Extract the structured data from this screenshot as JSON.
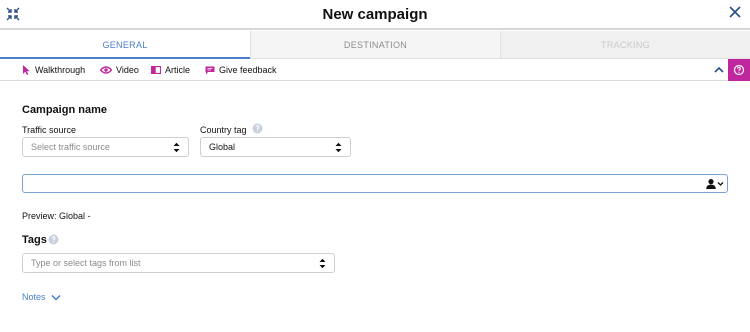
{
  "header": {
    "title": "New campaign"
  },
  "tabs": [
    {
      "label": "GENERAL"
    },
    {
      "label": "DESTINATION"
    },
    {
      "label": "TRACKING"
    }
  ],
  "helpbar": {
    "items": [
      {
        "label": "Walkthrough",
        "icon": "cursor-icon"
      },
      {
        "label": "Video",
        "icon": "eye-icon"
      },
      {
        "label": "Article",
        "icon": "book-icon"
      },
      {
        "label": "Give feedback",
        "icon": "chat-icon"
      }
    ]
  },
  "form": {
    "section_title": "Campaign name",
    "traffic_source": {
      "label": "Traffic source",
      "placeholder": "Select traffic source"
    },
    "country_tag": {
      "label": "Country tag",
      "value": "Global"
    },
    "campaign_name": {
      "value": ""
    },
    "preview": "Preview: Global -",
    "tags": {
      "title": "Tags",
      "placeholder": "Type or select tags from list"
    },
    "notes_label": "Notes"
  },
  "colors": {
    "accent": "#4a7fc9",
    "help_button": "#c0279e",
    "icon_magenta": "#c0279e"
  }
}
